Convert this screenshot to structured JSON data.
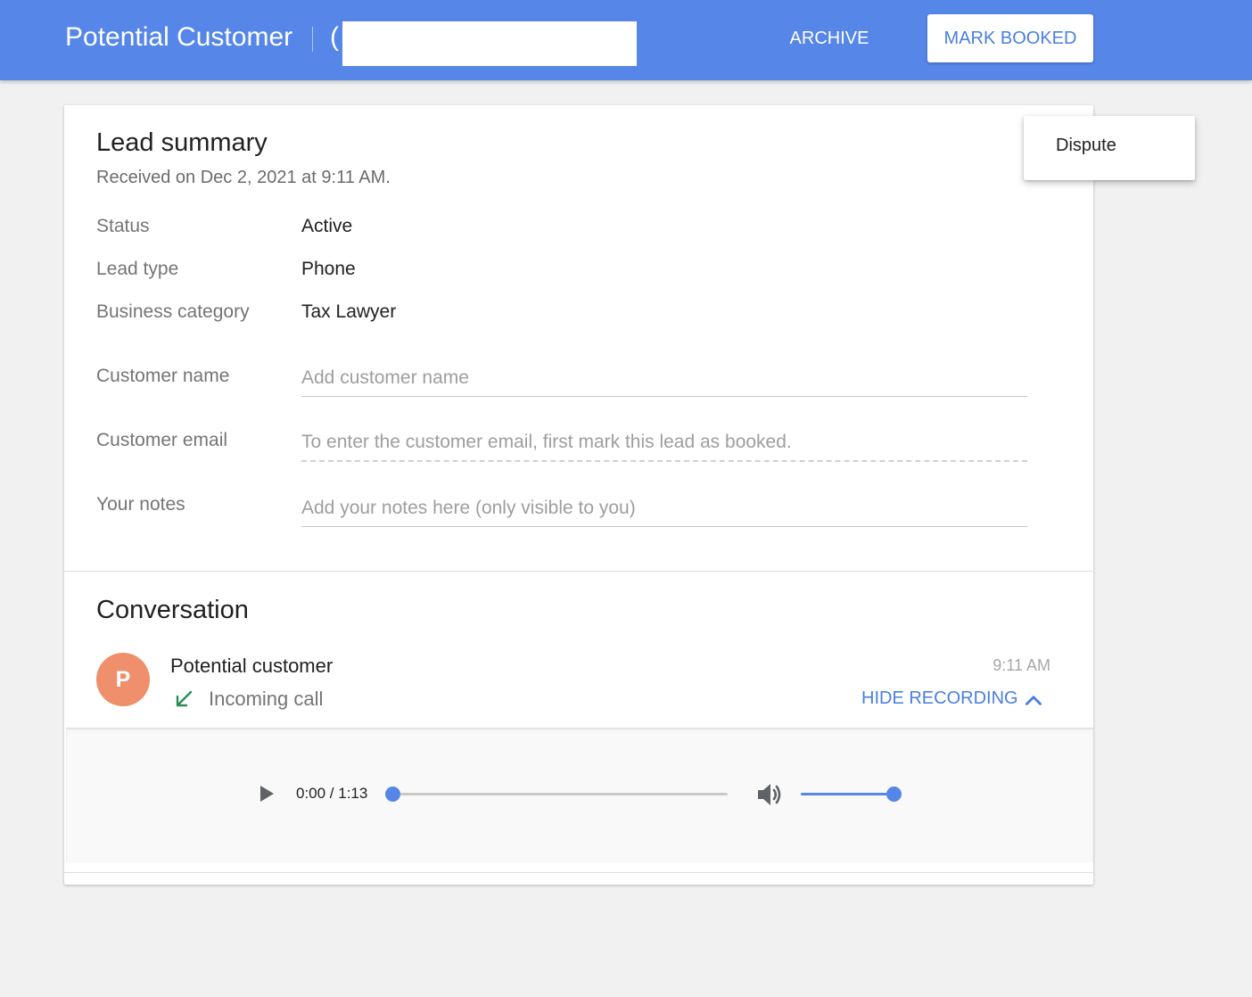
{
  "header": {
    "title": "Potential Customer",
    "phone_prefix": "(",
    "archive_label": "ARCHIVE",
    "mark_booked_label": "MARK BOOKED"
  },
  "menu": {
    "items": [
      {
        "label": "Dispute"
      }
    ]
  },
  "lead_summary": {
    "title": "Lead summary",
    "received": "Received on Dec 2, 2021 at 9:11 AM.",
    "rows": [
      {
        "label": "Status",
        "value": "Active"
      },
      {
        "label": "Lead type",
        "value": "Phone"
      },
      {
        "label": "Business category",
        "value": "Tax Lawyer"
      }
    ],
    "fields": {
      "customer_name": {
        "label": "Customer name",
        "placeholder": "Add customer name"
      },
      "customer_email": {
        "label": "Customer email",
        "placeholder": "To enter the customer email, first mark this lead as booked."
      },
      "notes": {
        "label": "Your notes",
        "placeholder": "Add your notes here (only visible to you)"
      }
    }
  },
  "conversation": {
    "title": "Conversation",
    "avatar_letter": "P",
    "avatar_color": "#ef8f6c",
    "caller": "Potential customer",
    "call_type": "Incoming call",
    "time": "9:11 AM",
    "hide_recording_label": "HIDE RECORDING",
    "player": {
      "time_readout": "0:00 / 1:13",
      "progress": 0.0,
      "volume": 1.0
    }
  },
  "colors": {
    "brand": "#5686e8",
    "accent_text": "#4a7fe0",
    "incoming_call": "#2e8b57"
  }
}
